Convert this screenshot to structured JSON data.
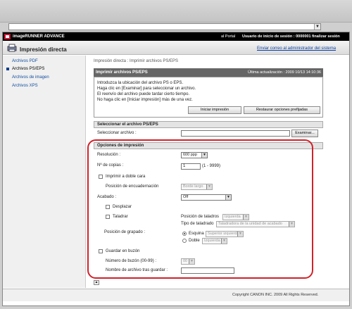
{
  "brand": {
    "name": "imageRUNNER ADVANCE",
    "portal_link": "al Portal",
    "user_info": "Usuario de inicio de sesión : 0000001 finalizar sesión"
  },
  "header": {
    "title": "Impresión directa",
    "send_admin_link": "Enviar correo al administrador del sistema"
  },
  "sidebar": {
    "items": [
      {
        "label": "Archivos PDF"
      },
      {
        "label": "Archivos PS/EPS"
      },
      {
        "label": "Archivos de imagen"
      },
      {
        "label": "Archivos XPS"
      }
    ]
  },
  "main": {
    "breadcrumb": "Impresión directa : Imprimir archivos PS/EPS",
    "panel_title": "Imprimir archivos PS/EPS",
    "last_update": "Última actualización : 2009 10/13 14:10:36",
    "instructions": [
      "Introduzca la ubicación del archivo PS o EPS.",
      "Haga clic en [Examinar] para seleccionar un archivo.",
      "El reenvío del archivo puede tardar cierto tiempo.",
      "No haga clic en [Iniciar impresión] más de una vez."
    ],
    "start_print_button": "Iniciar impresión",
    "restore_defaults_button": "Restaurar opciones prefijadas",
    "select_file_section": "Seleccionar el archivo PS/EPS",
    "select_file_label": "Seleccionar archivo :",
    "browse_button": "Examinar..."
  },
  "options": {
    "section_title": "Opciones de impresión",
    "resolution_label": "Resolución :",
    "resolution_value": "600 ppp",
    "copies_label": "Nº de copias :",
    "copies_value": "1",
    "copies_range": "(1 - 9999)",
    "duplex_label": "Imprimir a doble cara",
    "binding_label": "Posición de encuadernación",
    "binding_value": "Borde largo",
    "finishing_label": "Acabado :",
    "finishing_value": "Off",
    "offset_label": "Desplazar",
    "punch_label": "Taladrar",
    "punch_position_label": "Posición de taladros",
    "punch_position_value": "Izquierda",
    "punch_type_label": "Tipo de taladrado",
    "punch_type_value": "Taladradora de la unidad de acabado",
    "staple_label": "Posición de grapado :",
    "corner_label": "Esquina",
    "corner_value": "Superior izquierda",
    "double_label": "Doble",
    "double_value": "Izquierda",
    "save_box_label": "Guardar en buzón",
    "box_number_label": "Número de buzón (00-99) :",
    "box_number_value": "00",
    "file_name_label": "Nombre de archivo tras guardar :"
  },
  "footer": {
    "copyright": "Copyright CANON INC. 2009 All Rights Reserved.",
    "top_icon": "top-arrow-icon"
  },
  "colors": {
    "highlight": "#d0222a",
    "link": "#0c40a0",
    "header_bar": "#666666"
  }
}
